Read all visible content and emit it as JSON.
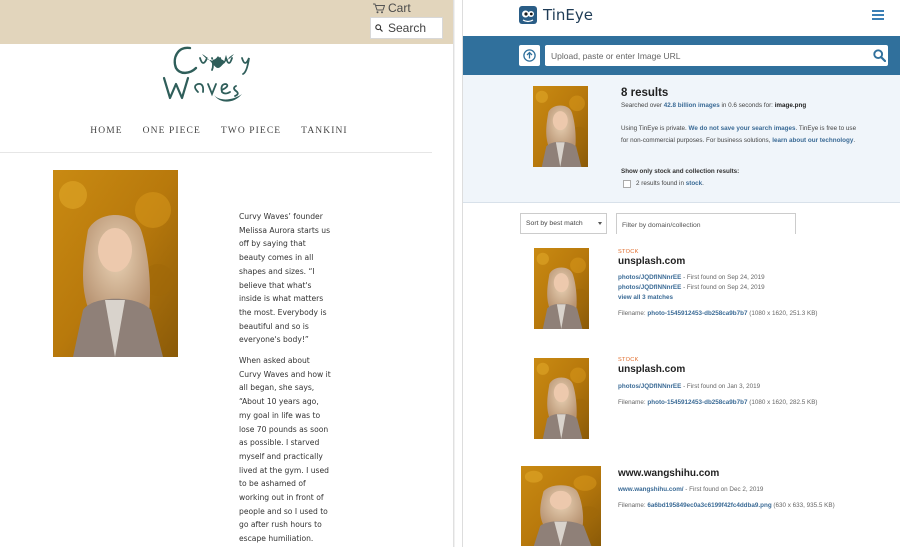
{
  "left": {
    "cart_label": "Cart",
    "search_placeholder": "Search",
    "nav": [
      "HOME",
      "ONE PIECE",
      "TWO PIECE",
      "TANKINI"
    ],
    "logo_text": "Curvy Waves",
    "article": [
      "Curvy Waves’ founder Melissa Aurora starts us off by saying that beauty comes in all shapes and sizes. “I believe that what's inside is what matters the most. Everybody is beautiful and so is everyone's body!”",
      "When asked about Curvy Waves and how it all began, she says, “About 10 years ago, my goal in life was to lose 70 pounds as soon as possible. I starved myself and practically lived at the gym. I used to be ashamed of working out in front of people and so I used to go after rush hours to escape humiliation. Curvy Waves"
    ]
  },
  "right": {
    "brand": "TinEye",
    "url_placeholder": "Upload, paste or enter Image URL",
    "results_title": "8 results",
    "searched_pre": "Searched over ",
    "searched_count": "42.8 billion images",
    "searched_post": " in 0.6 seconds for: ",
    "searched_file": "image.png",
    "privacy_1": "Using TinEye is private. ",
    "privacy_link": "We do not save your search images",
    "privacy_2": ". TinEye is free to use for non-commercial purposes. For business solutions, ",
    "privacy_link2": "learn about our technology",
    "privacy_3": ".",
    "stock_title": "Show only stock and collection results:",
    "stock_pre": "2 results found in ",
    "stock_link": "stock",
    "stock_post": ".",
    "sort_label": "Sort by best match",
    "filter_placeholder": "Filter by domain/collection",
    "results": [
      {
        "tag": "STOCK",
        "domain": "unsplash.com",
        "links": [
          {
            "path": "photos/JQDflNNnrEE",
            "meta": " - First found on Sep 24, 2019"
          },
          {
            "path": "photos/JQDflNNnrEE",
            "meta": " - First found on Sep 24, 2019"
          }
        ],
        "view_all": "view all 3 matches",
        "filename_label": "Filename: ",
        "filename": "photo-1545912453-db258ca9b7b7",
        "filesize": " (1080 x 1620, 251.3 KB)"
      },
      {
        "tag": "STOCK",
        "domain": "unsplash.com",
        "links": [
          {
            "path": "photos/JQDflNNnrEE",
            "meta": " - First found on Jan 3, 2019"
          }
        ],
        "filename_label": "Filename: ",
        "filename": "photo-1545912453-db258ca9b7b7",
        "filesize": " (1080 x 1620, 282.5 KB)"
      },
      {
        "tag": "",
        "domain": "www.wangshihu.com",
        "links": [
          {
            "path": "www.wangshihu.com/",
            "meta": " - First found on Dec 2, 2019"
          }
        ],
        "filename_label": "Filename: ",
        "filename": "6a6bd195849ec0a3c6199f42fc4ddba9.png",
        "filesize": " (630 x 633, 935.5 KB)"
      }
    ]
  },
  "colors": {
    "left_topbar": "#e2d5bc",
    "tineye_bar": "#30709c",
    "tineye_summary_bg": "#f0f5fa",
    "link_blue": "#3b6b96",
    "stock_orange": "#e06c2b",
    "logo_teal": "#2f5e5a"
  }
}
